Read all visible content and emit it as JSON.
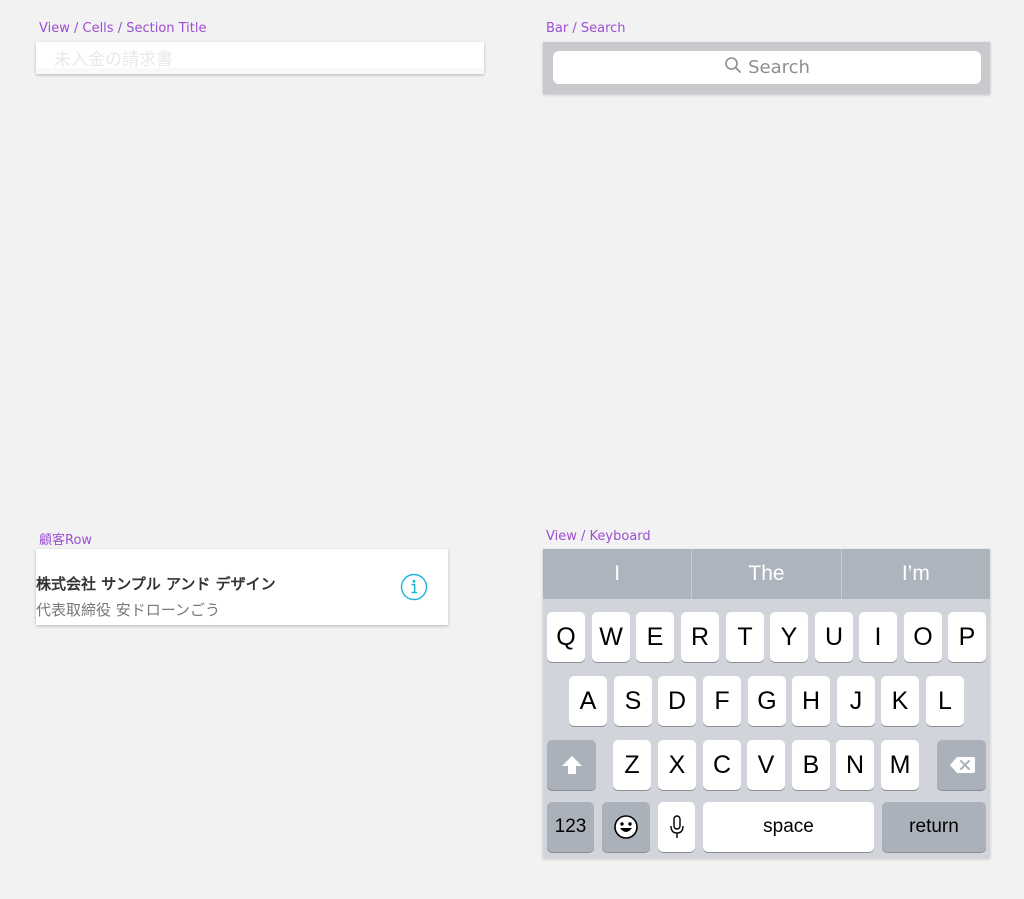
{
  "artboards": {
    "section_title": "View / Cells / Section Title",
    "search": "Bar / Search",
    "customer_row": "顧客Row",
    "keyboard": "View / Keyboard"
  },
  "section_cell": {
    "title": "未入金の請求書"
  },
  "search_bar": {
    "placeholder": "Search",
    "icon": "search-icon"
  },
  "customer_row": {
    "company": "株式会社 サンプル アンド デザイン",
    "person": "代表取締役 安ドローンごう",
    "icon": "info-icon",
    "accent": "#1fb5d6"
  },
  "keyboard": {
    "suggestions": [
      "I",
      "The",
      "I’m"
    ],
    "row1": [
      "Q",
      "W",
      "E",
      "R",
      "T",
      "Y",
      "U",
      "I",
      "O",
      "P"
    ],
    "row2": [
      "A",
      "S",
      "D",
      "F",
      "G",
      "H",
      "J",
      "K",
      "L"
    ],
    "row3": [
      "Z",
      "X",
      "C",
      "V",
      "B",
      "N",
      "M"
    ],
    "numbers_label": "123",
    "space_label": "space",
    "return_label": "return",
    "icons": [
      "shift-icon",
      "delete-icon",
      "emoji-icon",
      "microphone-icon"
    ]
  }
}
